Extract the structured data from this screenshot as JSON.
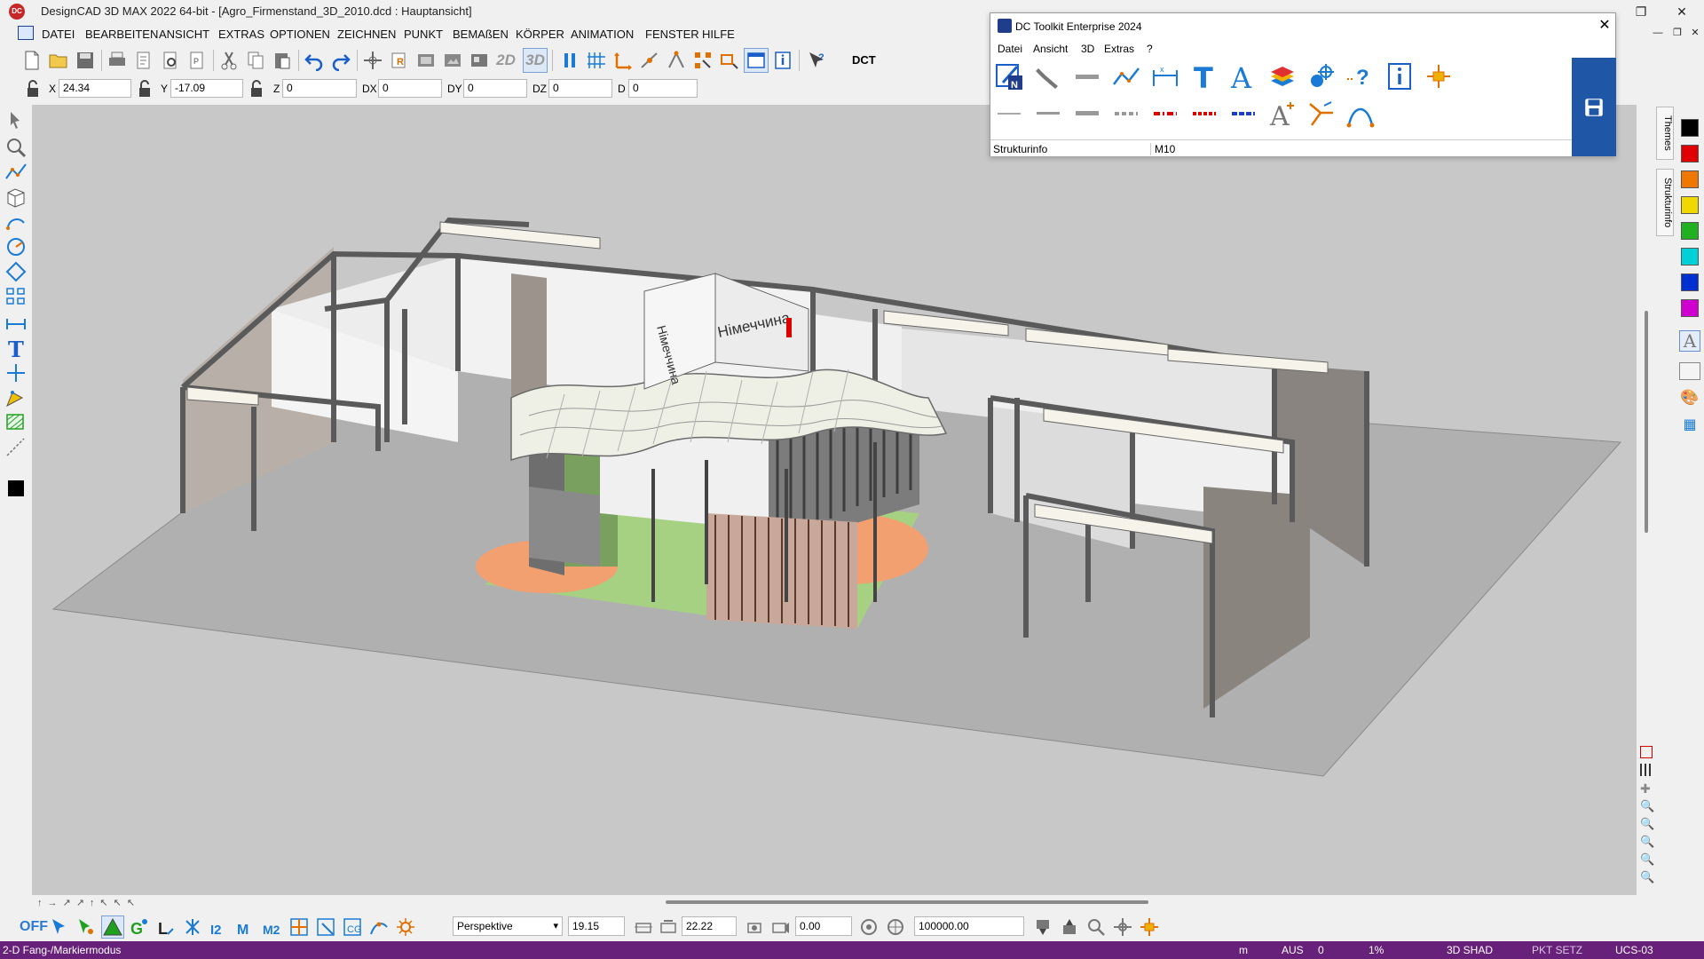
{
  "window": {
    "title": "DesignCAD 3D MAX 2022 64-bit - [Agro_Firmenstand_3D_2010.dcd : Hauptansicht]",
    "logo_text": "DC",
    "minimize": "—",
    "maximize": "❐",
    "close": "✕",
    "doc_minimize": "—",
    "doc_restore": "❐",
    "doc_close": "✕"
  },
  "menu": [
    "DATEI",
    "BEARBEITEN",
    "ANSICHT",
    "EXTRAS",
    "OPTIONEN",
    "ZEICHNEN",
    "PUNKT",
    "BEMAßEN",
    "KÖRPER",
    "ANIMATION",
    "FENSTER",
    "HILFE"
  ],
  "toolbar": {
    "view2d": "2D",
    "view3d": "3D",
    "dct": "DCT"
  },
  "coords": {
    "x_label": "X",
    "x_value": "24.34",
    "y_label": "Y",
    "y_value": "-17.09",
    "z_label": "Z",
    "z_value": "0",
    "dx_label": "DX",
    "dx_value": "0",
    "dy_label": "DY",
    "dy_value": "0",
    "dz_label": "DZ",
    "dz_value": "0",
    "d_label": "D",
    "d_value": "0"
  },
  "toolkit": {
    "title": "DC Toolkit Enterprise 2024",
    "close": "✕",
    "menu": [
      "Datei",
      "Ansicht",
      "3D",
      "Extras",
      "?"
    ],
    "info_left": "Strukturinfo",
    "info_right": "M10"
  },
  "side_tabs": [
    "Themes",
    "Strukturinfo"
  ],
  "palette": [
    "#000000",
    "#e00000",
    "#f07800",
    "#f0d800",
    "#20b020",
    "#00d0d8",
    "#0030d0",
    "#d000d0"
  ],
  "scene": {
    "banner_text": "Німеччина",
    "small_banner": "Німеччина"
  },
  "bottombar": {
    "off_label": "OFF",
    "view_mode": "Perspektive",
    "angle": "19.15",
    "distance": "22.22",
    "rotation": "0.00",
    "range": "100000.00"
  },
  "status": {
    "mode": "2-D Fang-/Markiermodus",
    "unit": "m",
    "state": "AUS",
    "count": "0",
    "percent": "1%",
    "shade": "3D SHAD",
    "pkt": "PKT SETZ",
    "ucs": "UCS-03"
  }
}
